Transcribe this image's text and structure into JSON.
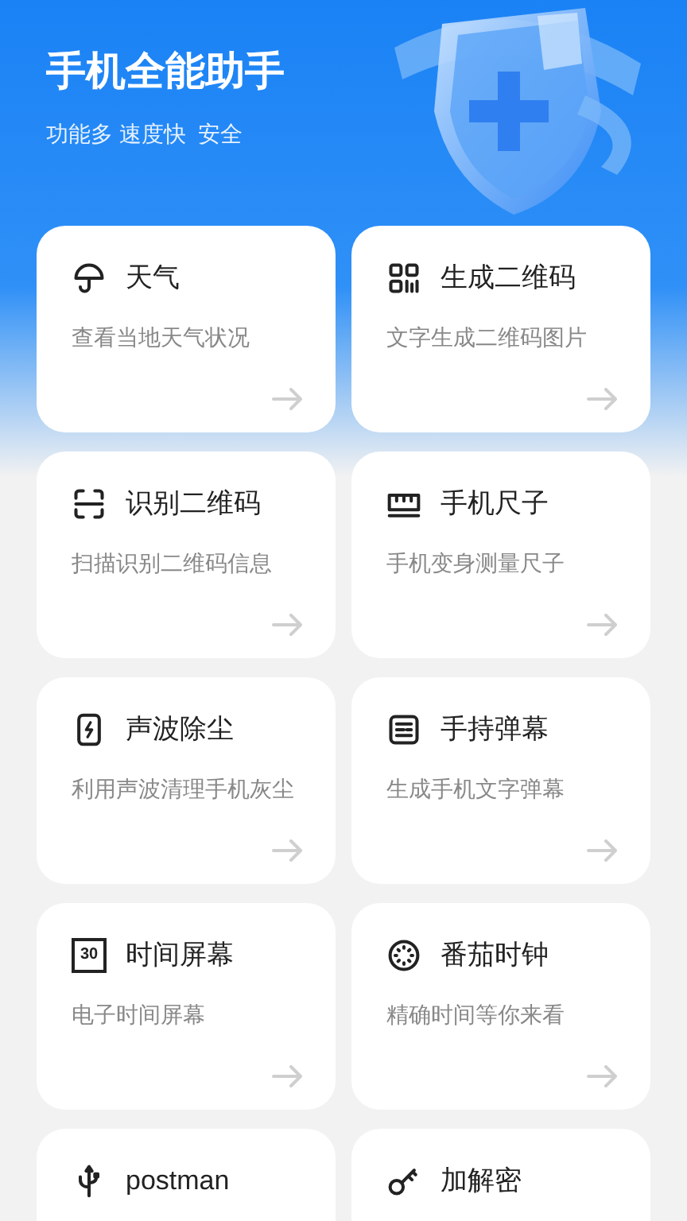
{
  "header": {
    "title": "手机全能助手",
    "tagline": "功能多 速度快  安全"
  },
  "tools": [
    {
      "title": "天气",
      "description": "查看当地天气状况"
    },
    {
      "title": "生成二维码",
      "description": "文字生成二维码图片"
    },
    {
      "title": "识别二维码",
      "description": "扫描识别二维码信息"
    },
    {
      "title": "手机尺子",
      "description": "手机变身测量尺子"
    },
    {
      "title": "声波除尘",
      "description": "利用声波清理手机灰尘"
    },
    {
      "title": "手持弹幕",
      "description": "生成手机文字弹幕"
    },
    {
      "badge": "30",
      "title": "时间屏幕",
      "description": "电子时间屏幕"
    },
    {
      "title": "番茄时钟",
      "description": "精确时间等你来看"
    },
    {
      "title": "postman"
    },
    {
      "title": "加解密"
    }
  ]
}
